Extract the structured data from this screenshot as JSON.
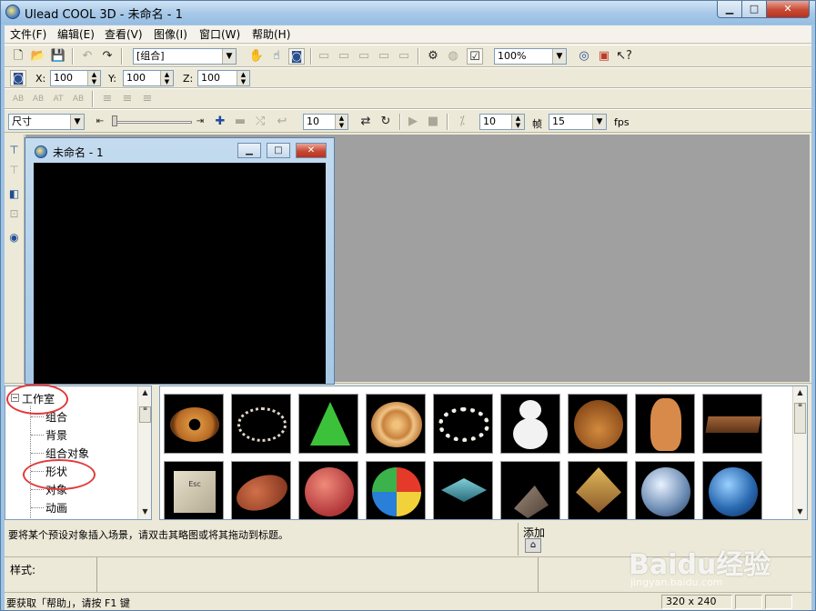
{
  "window": {
    "title": "Ulead COOL 3D - 未命名 - 1",
    "buttons": {
      "minimize": "▁",
      "maximize": "□",
      "close": "✕"
    }
  },
  "menu": [
    "文件(F)",
    "编辑(E)",
    "查看(V)",
    "图像(I)",
    "窗口(W)",
    "帮助(H)"
  ],
  "toolbar1": {
    "group_combo": "[组合]",
    "zoom_combo": "100%"
  },
  "toolbar2": {
    "x_label": "X:",
    "x_value": "100",
    "y_label": "Y:",
    "y_value": "100",
    "z_label": "Z:",
    "z_value": "100"
  },
  "toolbar3": {
    "text_btns": [
      "AB",
      "AB",
      "AT",
      "AB"
    ]
  },
  "toolbar4": {
    "size_combo": "尺寸",
    "frame_value": "10",
    "frame2_value": "10",
    "frame_label": "帧",
    "fps_combo": "15",
    "fps_label": "fps"
  },
  "doc_window": {
    "title": "未命名 - 1",
    "buttons": {
      "minimize": "▁",
      "maximize": "□",
      "close": "✕"
    }
  },
  "tree": {
    "root": "工作室",
    "items": [
      "组合",
      "背景",
      "组合对象",
      "形状",
      "对象",
      "动画"
    ]
  },
  "gallery": {
    "items": [
      "donut",
      "ring",
      "cone",
      "cinnamon-roll",
      "pearl-necklace",
      "snowman",
      "bear",
      "gingerbread",
      "chocolate-bar",
      "esc-key",
      "football",
      "basketball",
      "beach-ball",
      "spinning-top",
      "pine-cone",
      "pyramid-face",
      "glass-sphere",
      "earth"
    ]
  },
  "hint": "要将某个预设对象插入场景，请双击其略图或将其拖动到标题。",
  "add_label": "添加",
  "style_label": "样式:",
  "status": {
    "help_text": "要获取「帮助」，请按 F1 键",
    "size": "320 x 240"
  },
  "watermark": {
    "logo": "Baidu经验",
    "url": "jingyan.baidu.com"
  },
  "colors": {
    "annotation": "#e23a3a",
    "canvas": "#000000",
    "workspace": "#a0a0a0"
  }
}
